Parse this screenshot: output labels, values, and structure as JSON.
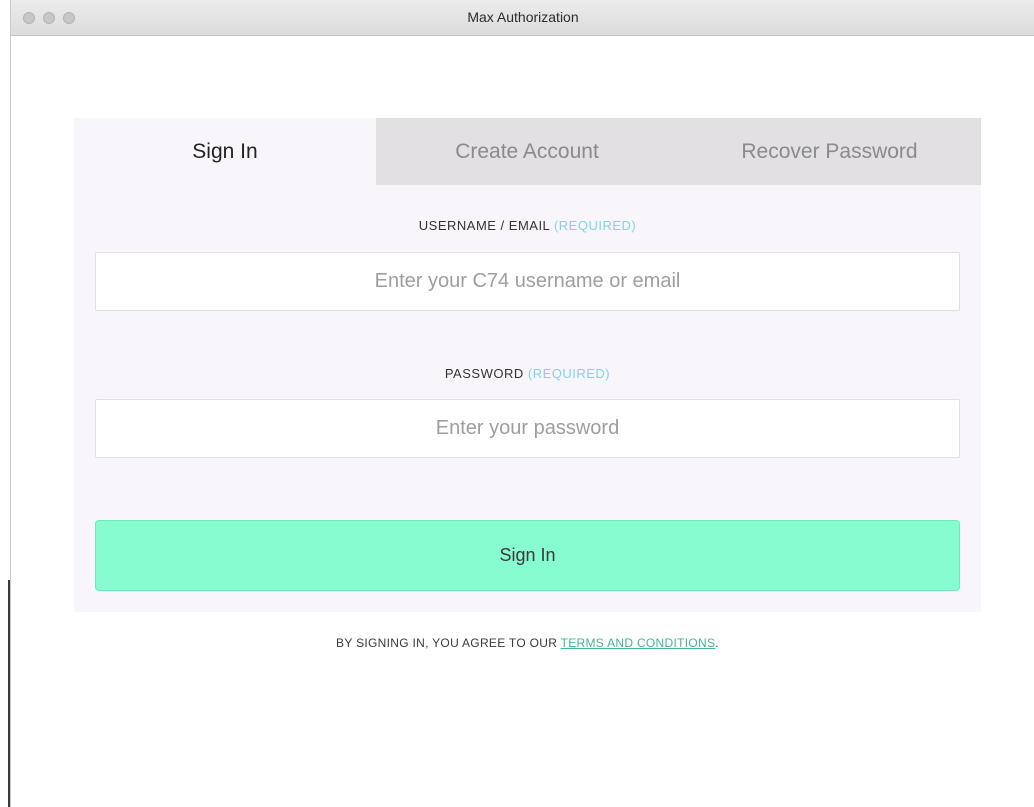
{
  "window": {
    "title": "Max Authorization"
  },
  "tabs": [
    {
      "label": "Sign In",
      "active": true
    },
    {
      "label": "Create Account",
      "active": false
    },
    {
      "label": "Recover Password",
      "active": false
    }
  ],
  "form": {
    "username": {
      "label": "USERNAME / EMAIL",
      "required": "(REQUIRED)",
      "placeholder": "Enter your C74 username or email",
      "value": ""
    },
    "password": {
      "label": "PASSWORD",
      "required": "(REQUIRED)",
      "placeholder": "Enter your password",
      "value": ""
    },
    "submit_label": "Sign In"
  },
  "terms": {
    "prefix": "BY SIGNING IN, YOU AGREE TO OUR ",
    "link": "TERMS AND CONDITIONS",
    "suffix": "."
  },
  "colors": {
    "accent_button": "#86fcd0",
    "required": "#7fd3ee",
    "link": "#46b493"
  },
  "icons": {
    "close": "traffic-light-close-icon",
    "minimize": "traffic-light-minimize-icon",
    "zoom": "traffic-light-zoom-icon"
  }
}
